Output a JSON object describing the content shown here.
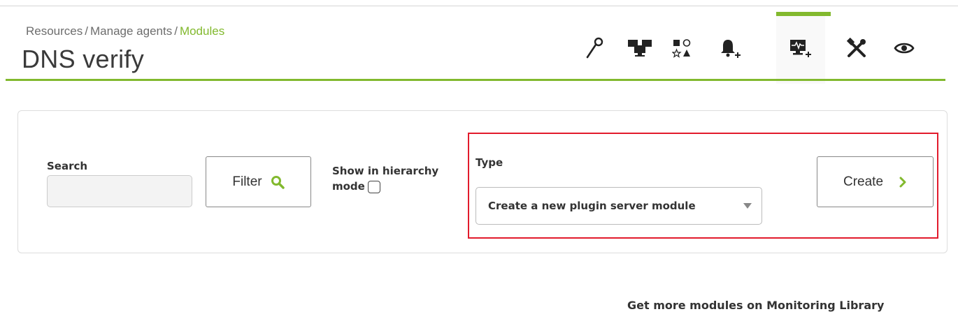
{
  "breadcrumb": {
    "items": [
      "Resources",
      "Manage agents"
    ],
    "separator": "/",
    "current": "Modules"
  },
  "page_title": "DNS verify",
  "toolbar": {
    "icons": [
      "wrench-icon",
      "network-agents-icon",
      "shapes-icon",
      "bell-add-icon",
      "monitor-add-icon",
      "tools-icon",
      "eye-icon"
    ],
    "active_icon": "monitor-add-icon",
    "accent_color": "#82b92e"
  },
  "filter": {
    "search_label": "Search",
    "search_value": "",
    "filter_button": "Filter",
    "hierarchy_label_line1": "Show in hierarchy",
    "hierarchy_label_line2": "mode",
    "hierarchy_checked": false
  },
  "create": {
    "type_label": "Type",
    "type_selected": "Create a new plugin server module",
    "create_button": "Create",
    "highlight_color": "#e21b2c"
  },
  "footer": {
    "library_link": "Get more modules on Monitoring Library"
  }
}
